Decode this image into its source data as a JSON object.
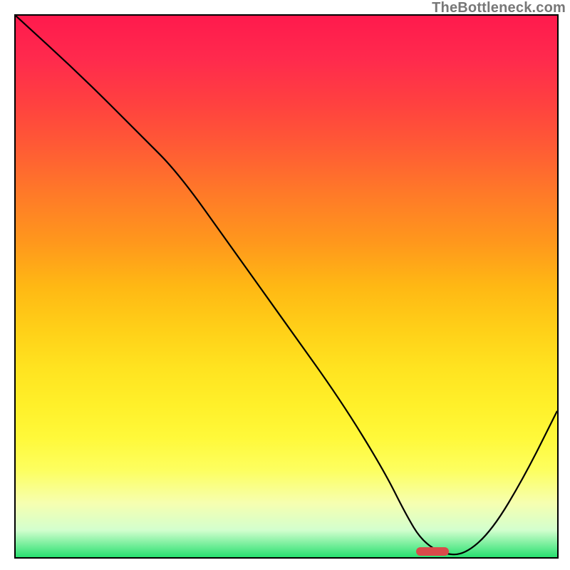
{
  "watermark": "TheBottleneck.com",
  "colors": {
    "curve_stroke": "#000000",
    "border": "#000000",
    "marker": "#d94a4a",
    "watermark": "#777777"
  },
  "chart_data": {
    "type": "line",
    "title": "",
    "xlabel": "",
    "ylabel": "",
    "xlim": [
      0,
      100
    ],
    "ylim": [
      0,
      100
    ],
    "grid": false,
    "axes_ticks": [],
    "note": "Axis ticks and units are not labeled in the image; x and y positions are read from the plot area as percentages (0–100). y=100 is the top (red); y=0 is the bottom (green).",
    "series": [
      {
        "name": "bottleneck-curve",
        "x": [
          0,
          12,
          23,
          30,
          40,
          50,
          60,
          68,
          72,
          75,
          79,
          83,
          88,
          94,
          100
        ],
        "y": [
          100,
          89,
          78,
          71,
          57,
          43,
          29,
          16,
          8,
          3,
          0.5,
          0.5,
          5,
          15,
          27
        ]
      }
    ],
    "marker": {
      "name": "optimal-range",
      "x_center": 77,
      "width_percent": 6,
      "y": 1,
      "color": "#d94a4a"
    }
  }
}
